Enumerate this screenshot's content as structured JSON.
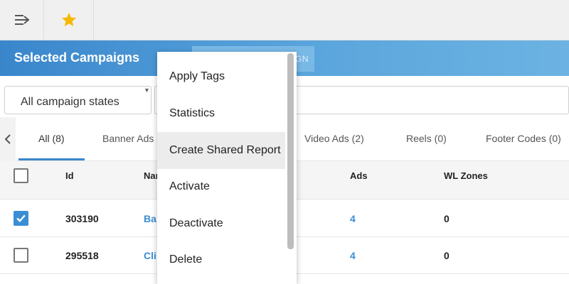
{
  "header": {
    "title": "Selected Campaigns",
    "button_label": "GN"
  },
  "filters": {
    "state_select": "All campaign states",
    "search_value": ""
  },
  "tabs": [
    {
      "label": "All (8)"
    },
    {
      "label": "Banner Ads"
    },
    {
      "label": "Video Ads (2)"
    },
    {
      "label": "Reels (0)"
    },
    {
      "label": "Footer Codes (0)"
    }
  ],
  "table": {
    "columns": {
      "id": "Id",
      "name": "Nar",
      "ads": "Ads",
      "wl_zones": "WL Zones"
    },
    "rows": [
      {
        "id": "303190",
        "name": "Ba",
        "ads": "4",
        "wl_zones": "0",
        "checked": true
      },
      {
        "id": "295518",
        "name": "Cli",
        "ads": "4",
        "wl_zones": "0",
        "checked": false
      }
    ]
  },
  "menu": {
    "items": [
      {
        "label": "Apply Tags"
      },
      {
        "label": "Statistics"
      },
      {
        "label": "Create Shared Report"
      },
      {
        "label": "Activate"
      },
      {
        "label": "Deactivate"
      },
      {
        "label": "Delete"
      }
    ],
    "hovered_index": 2
  },
  "colors": {
    "accent": "#3a86cc",
    "link": "#3a8ed4",
    "star": "#f5b800"
  },
  "icons": {
    "menu": "collapse-menu-icon",
    "favorite": "star-icon",
    "back": "chevron-left-icon"
  }
}
